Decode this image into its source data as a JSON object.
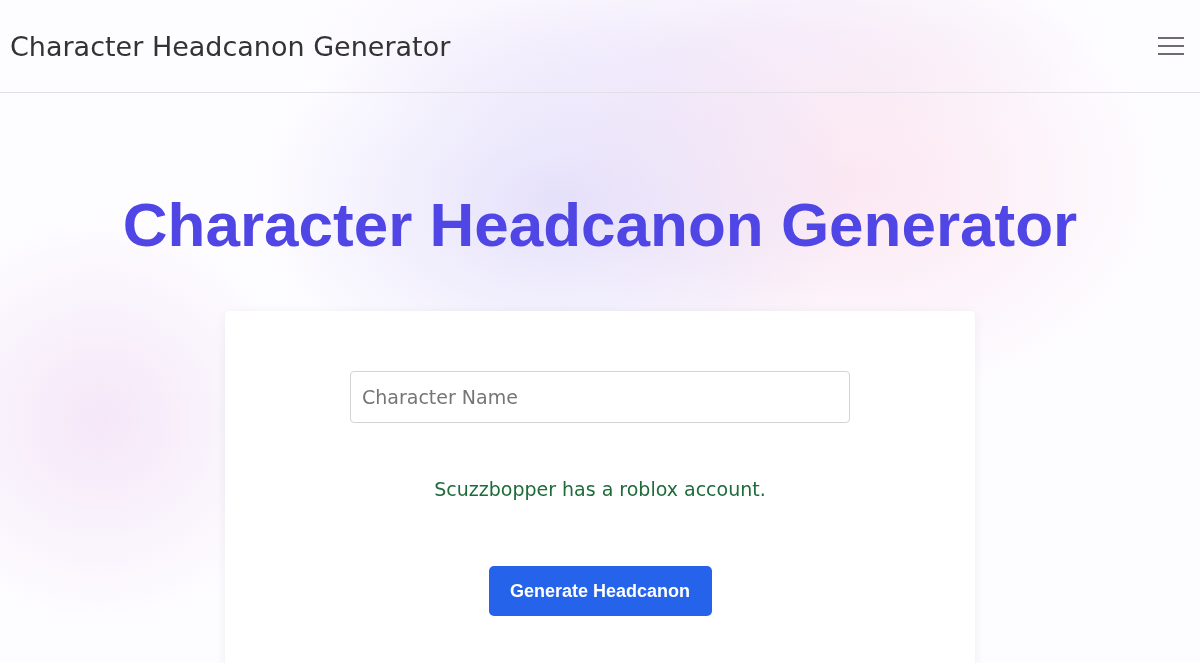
{
  "header": {
    "title": "Character Headcanon Generator"
  },
  "hero": {
    "title": "Character Headcanon Generator"
  },
  "form": {
    "name_field": {
      "placeholder": "Character Name"
    },
    "result": "Scuzzbopper has a roblox account.",
    "button": "Generate Headcanon"
  }
}
